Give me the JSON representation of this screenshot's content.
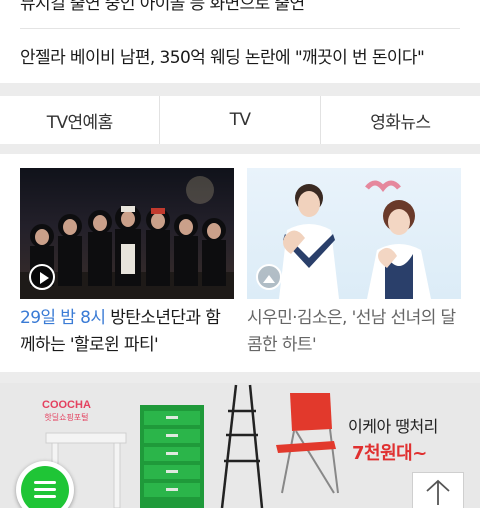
{
  "news": {
    "items": [
      {
        "title": "뮤지컬 출연 중인 아이돌 등 화면으로 출연"
      },
      {
        "title": "안젤라 베이비 남편, 350억 웨딩 논란에 \"깨끗이 번 돈이다\""
      }
    ]
  },
  "tabs": [
    {
      "label": "TV연예홈"
    },
    {
      "label": "TV"
    },
    {
      "label": "영화뉴스"
    }
  ],
  "cards": [
    {
      "caption_highlight": "29일 밤 8시",
      "caption_text": " 방탄소년단과 함께하는 '할로윈 파티'",
      "badge_icon": "play-icon"
    },
    {
      "caption_text": "시우민·김소은, '선남 선녀의 달콤한 하트'",
      "badge_icon": "photo-icon"
    }
  ],
  "ad": {
    "brand": "COOCHA",
    "brand_sub": "핫딜쇼핑포털",
    "headline": "이케아 땡처리",
    "price": "7천원대~"
  },
  "colors": {
    "accent_green": "#1fc536",
    "highlight_blue": "#3a7bd5",
    "ad_red": "#e03030"
  }
}
